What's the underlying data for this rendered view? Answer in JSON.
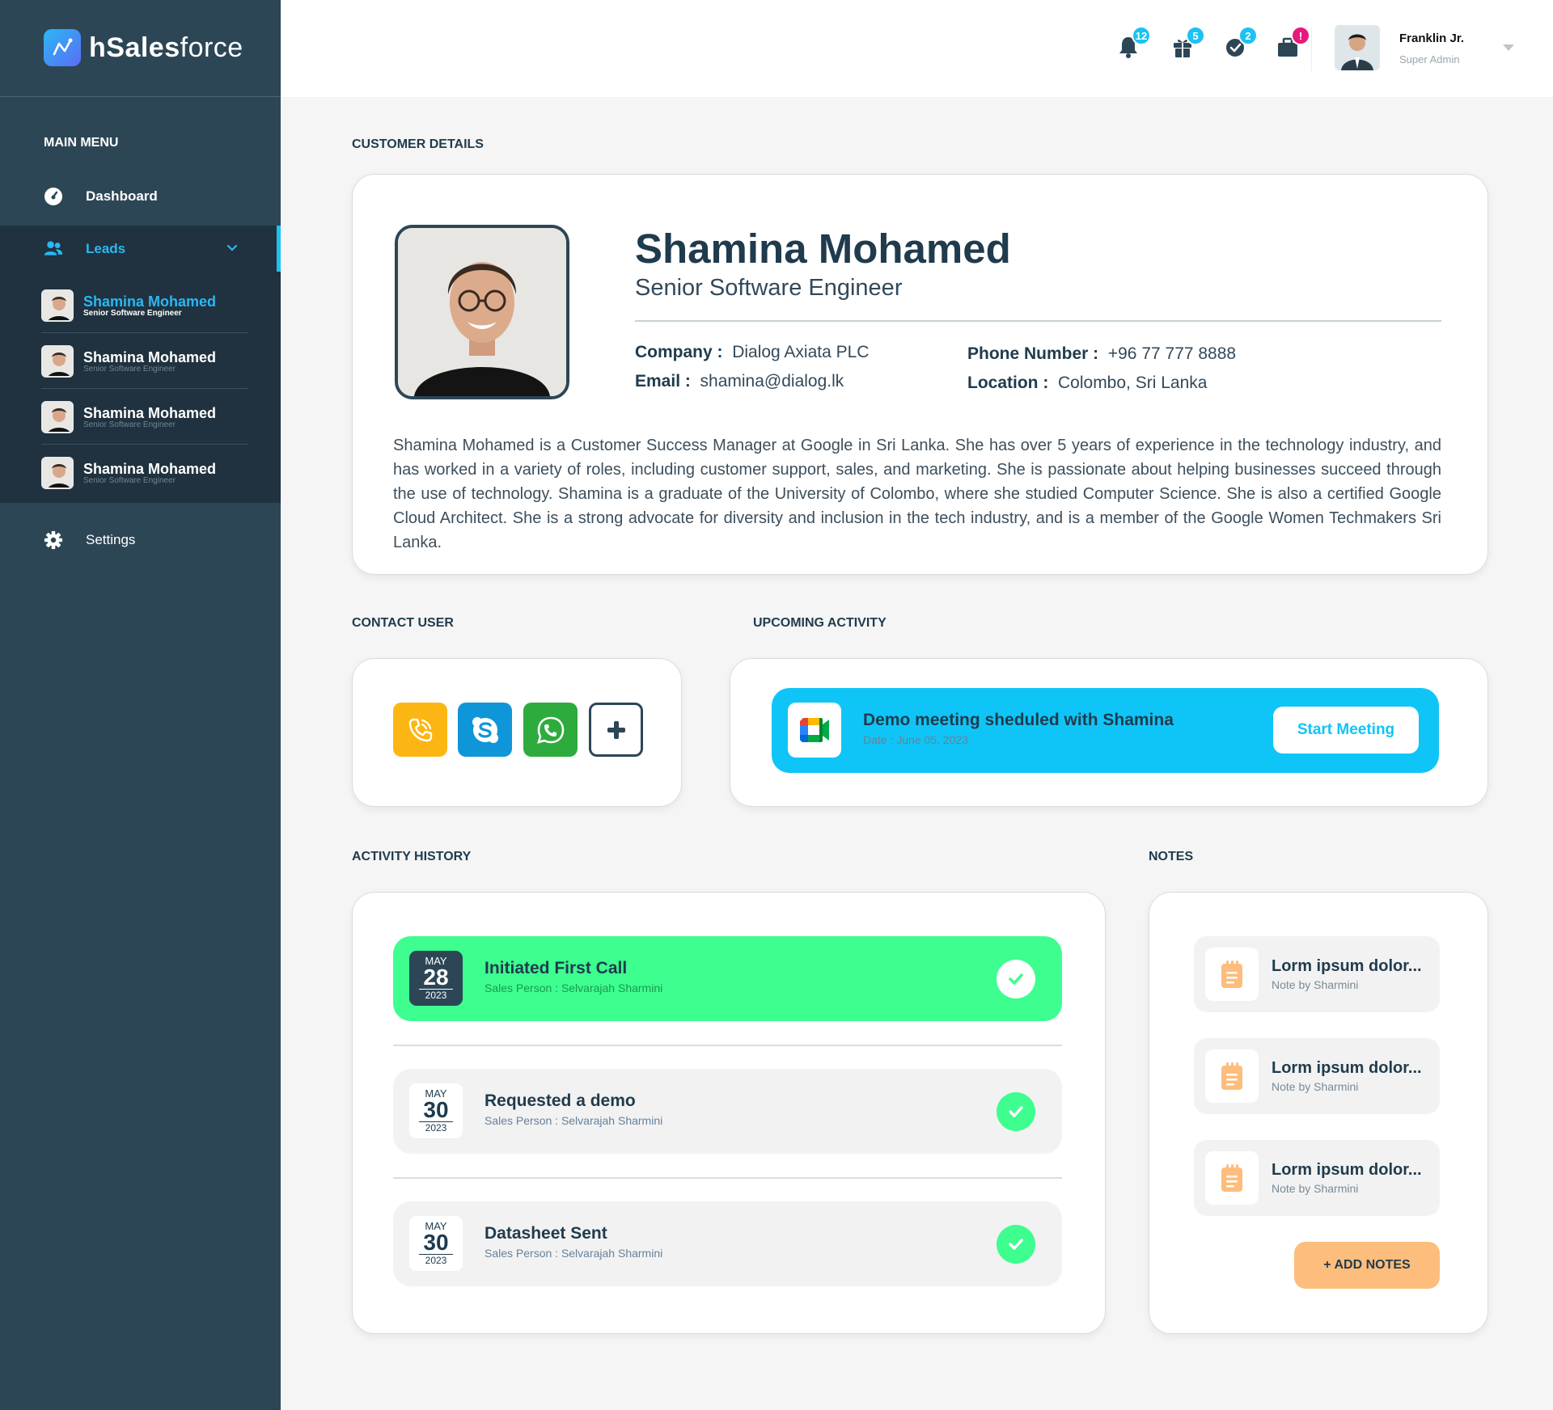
{
  "brand": {
    "name_bold": "hSales",
    "name_light": "force"
  },
  "sidebar": {
    "section_title": "MAIN MENU",
    "dashboard": "Dashboard",
    "leads": "Leads",
    "lead_items": [
      {
        "name": "Shamina Mohamed",
        "title": "Senior Software Engineer",
        "active": true
      },
      {
        "name": "Shamina Mohamed",
        "title": "Senior Software Engineer",
        "active": false
      },
      {
        "name": "Shamina Mohamed",
        "title": "Senior Software Engineer",
        "active": false
      },
      {
        "name": "Shamina Mohamed",
        "title": "Senior Software Engineer",
        "active": false
      }
    ],
    "settings": "Settings"
  },
  "topbar": {
    "badges": {
      "notifications": "12",
      "gifts": "5",
      "checks": "2",
      "alerts": "!"
    },
    "badge_colors": {
      "notifications": "#1ec1f4",
      "gifts": "#1ec1f4",
      "checks": "#1ec1f4",
      "alerts": "#e8197e"
    },
    "user": {
      "name": "Franklin Jr.",
      "role": "Super Admin"
    }
  },
  "customer": {
    "section_title": "CUSTOMER DETAILS",
    "name": "Shamina Mohamed",
    "title": "Senior Software Engineer",
    "company_label": "Company :",
    "company": "Dialog Axiata PLC",
    "email_label": "Email :",
    "email": "shamina@dialog.lk",
    "phone_label": "Phone Number :",
    "phone": "+96 77 777 8888",
    "location_label": "Location :",
    "location": "Colombo, Sri Lanka",
    "bio": "Shamina Mohamed is a Customer Success Manager at Google in Sri Lanka. She has over 5 years of experience in the technology industry, and has worked in a variety of roles, including customer support, sales, and marketing. She is passionate about helping businesses succeed through the use of technology. Shamina is a graduate of the University of Colombo, where she studied Computer Science. She is also a certified Google Cloud Architect. She is a strong advocate for diversity and inclusion in the tech industry, and is a member of the Google Women Techmakers Sri Lanka."
  },
  "contact": {
    "section_title": "CONTACT USER"
  },
  "upcoming": {
    "section_title": "UPCOMING ACTIVITY",
    "title": "Demo meeting sheduled with Shamina",
    "date": "Date : June 05, 2023",
    "button": "Start Meeting"
  },
  "history": {
    "section_title": "ACTIVITY HISTORY",
    "items": [
      {
        "month": "MAY",
        "day": "28",
        "year": "2023",
        "title": "Initiated First Call",
        "sub": "Sales Person : Selvarajah Sharmini",
        "highlighted": true
      },
      {
        "month": "MAY",
        "day": "30",
        "year": "2023",
        "title": "Requested a demo",
        "sub": "Sales Person : Selvarajah Sharmini",
        "highlighted": false
      },
      {
        "month": "MAY",
        "day": "30",
        "year": "2023",
        "title": "Datasheet Sent",
        "sub": "Sales Person : Selvarajah Sharmini",
        "highlighted": false
      }
    ]
  },
  "notes": {
    "section_title": "NOTES",
    "items": [
      {
        "title": "Lorm ipsum dolor...",
        "sub": "Note by Sharmini"
      },
      {
        "title": "Lorm ipsum dolor...",
        "sub": "Note by Sharmini"
      },
      {
        "title": "Lorm ipsum dolor...",
        "sub": "Note by Sharmini"
      }
    ],
    "add_button": "+ ADD NOTES"
  },
  "colors": {
    "sidebar": "#2d4656",
    "accent": "#1ec1f4",
    "success": "#3dfe8f",
    "note_accent": "#fdbd7c"
  }
}
